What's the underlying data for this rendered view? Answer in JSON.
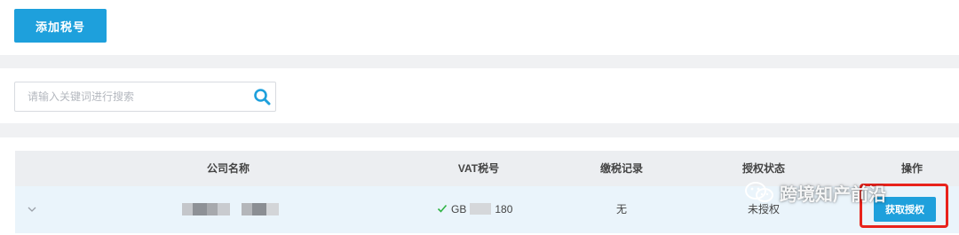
{
  "toolbar": {
    "add_label": "添加税号"
  },
  "search": {
    "placeholder": "请输入关键词进行搜索",
    "value": "",
    "icon": "search-icon"
  },
  "table": {
    "columns": [
      "公司名称",
      "VAT税号",
      "缴税记录",
      "授权状态",
      "操作"
    ],
    "rows": [
      {
        "company": "",
        "vat_prefix": "GB",
        "vat_suffix": "180",
        "tax_record": "无",
        "auth_status": "未授权",
        "action_label": "获取授权"
      }
    ]
  },
  "watermark": {
    "text": "跨境知产前沿"
  },
  "colors": {
    "primary": "#1ea0dc",
    "highlight": "#e8231c",
    "row_bg": "#eaf4fb",
    "header_bg": "#eceef1"
  }
}
